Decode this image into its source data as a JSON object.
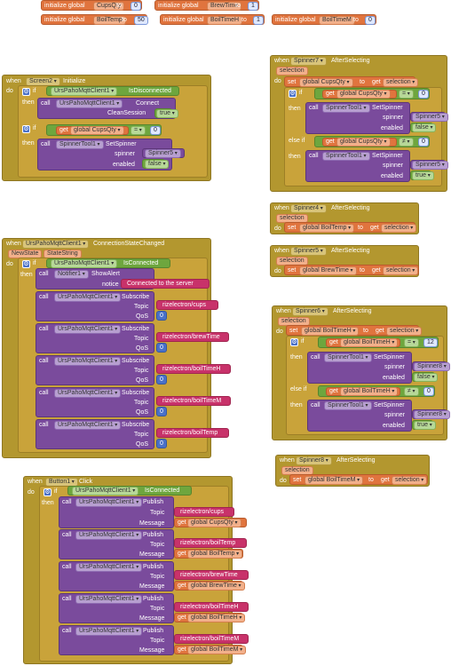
{
  "globals": [
    {
      "kw": "initialize global",
      "name": "CupsQty",
      "to": "to",
      "value": "0"
    },
    {
      "kw": "initialize global",
      "name": "BrewTime",
      "to": "to",
      "value": "1"
    },
    {
      "kw": "initialize global",
      "name": "BoilTemp",
      "to": "to",
      "value": "50"
    },
    {
      "kw": "initialize global",
      "name": "BoilTimeH",
      "to": "to",
      "value": "1"
    },
    {
      "kw": "initialize global",
      "name": "BoilTimeM",
      "to": "to",
      "value": "0"
    }
  ],
  "kw": {
    "when": "when",
    "do": "do",
    "if": "if",
    "then": "then",
    "else_if": "else if",
    "call": "call",
    "set": "set",
    "get": "get",
    "to": "to",
    "initialize": "Initialize",
    "connect": "Connect",
    "clean_session": "CleanSession",
    "set_spinner": "SetSpinner",
    "spinner": "spinner",
    "enabled": "enabled",
    "after_selecting": "AfterSelecting",
    "selection": "selection",
    "is_disconnected": "IsDisconnected",
    "is_connected": "IsConnected",
    "connection_state_changed": "ConnectionStateChanged",
    "new_state": "NewState",
    "state_string": "StateString",
    "show_alert": "ShowAlert",
    "notice": "notice",
    "subscribe": "Subscribe",
    "publish": "Publish",
    "topic": "Topic",
    "qos": "QoS",
    "message": "Message",
    "click": "Click",
    "true": "true",
    "false": "false",
    "eq": "=",
    "neq": "≠"
  },
  "components": {
    "screen": "Screen2",
    "mqtt": "UrsPahoMqttClient1",
    "spinner_tool": "SpinnerTool1",
    "notifier": "Notifier1",
    "button": "Button1",
    "spinner4": "Spinner4",
    "spinner5": "Spinner5",
    "spinner6": "Spinner6",
    "spinner7": "Spinner7",
    "spinner8": "Spinner8"
  },
  "vars": {
    "cups": "global CupsQty",
    "boiltemp": "global BoilTemp",
    "brewtime": "global BrewTime",
    "boiltimeh": "global BoilTimeH",
    "boiltimem": "global BoilTimeM",
    "selection": "selection"
  },
  "values": {
    "zero": "0",
    "twelve": "12",
    "qos0": "0"
  },
  "texts": {
    "connected": "Connected to the server",
    "topic_cups": "rizelectron/cups",
    "topic_brew": "rizelectron/brewTime",
    "topic_boilH": "rizelectron/boilTimeH",
    "topic_boilM": "rizelectron/boilTimeM",
    "topic_temp": "rizelectron/boilTemp"
  },
  "colors": {
    "event": "#b3972f",
    "control": "#c9a33a",
    "variable": "#e0743e",
    "component": "#7a4b9c",
    "logic": "#6ea63e",
    "math": "#4a71c8",
    "text": "#c8326a"
  }
}
